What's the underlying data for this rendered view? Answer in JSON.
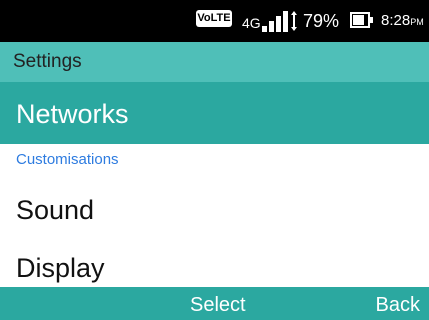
{
  "status_bar": {
    "volte_label": "VoLTE",
    "network_type": "4G",
    "battery_percent": "79%",
    "battery_level": 0.79,
    "time": "8:28",
    "time_suffix": "PM"
  },
  "header": {
    "title": "Settings"
  },
  "menu": {
    "items": [
      {
        "label": "Networks",
        "selected": true
      },
      {
        "label": "Sound",
        "selected": false
      },
      {
        "label": "Display",
        "selected": false
      }
    ],
    "section_header": "Customisations"
  },
  "softkeys": {
    "center": "Select",
    "right": "Back"
  },
  "colors": {
    "accent": "#2ba8a0",
    "header_bg": "#4fbfb8",
    "section_header_text": "#2e7ce0"
  }
}
